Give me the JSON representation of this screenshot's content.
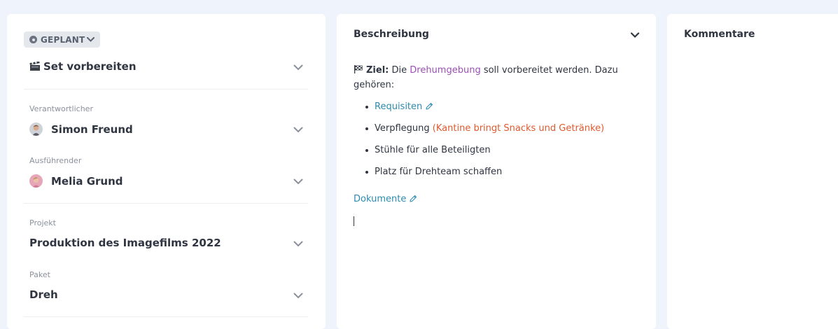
{
  "left": {
    "status": "GEPLANT",
    "task_title": "Set vorbereiten",
    "fields": [
      {
        "label": "Verantwortlicher",
        "value": "Simon Freund"
      },
      {
        "label": "Ausführender",
        "value": "Melia Grund"
      },
      {
        "label": "Projekt",
        "value": "Produktion des Imagefilms 2022"
      },
      {
        "label": "Paket",
        "value": "Dreh"
      }
    ]
  },
  "description": {
    "title": "Beschreibung",
    "goal_label": "Ziel:",
    "goal_pre": " Die ",
    "goal_link": "Drehumgebung",
    "goal_post": " soll vorbereitet werden. Dazu gehören:",
    "items": {
      "requisiten": "Requisiten",
      "verpflegung": "Verpflegung",
      "verpflegung_note": "(Kantine bringt Snacks und Getränke)",
      "stuehle": "Stühle für alle Beteiligten",
      "platz": "Platz für Drehteam schaffen"
    },
    "documents_link": "Dokumente"
  },
  "comments": {
    "title": "Kommentare"
  },
  "colors": {
    "background": "#eff3fb",
    "link": "#2d8bb0",
    "highlight_purple": "#9b4fb5",
    "highlight_orange": "#e2592c"
  },
  "icons": [
    "status-dot-icon",
    "chevron-down-icon",
    "clapperboard-icon",
    "avatar",
    "checkered-flag-icon",
    "pencil-icon"
  ]
}
